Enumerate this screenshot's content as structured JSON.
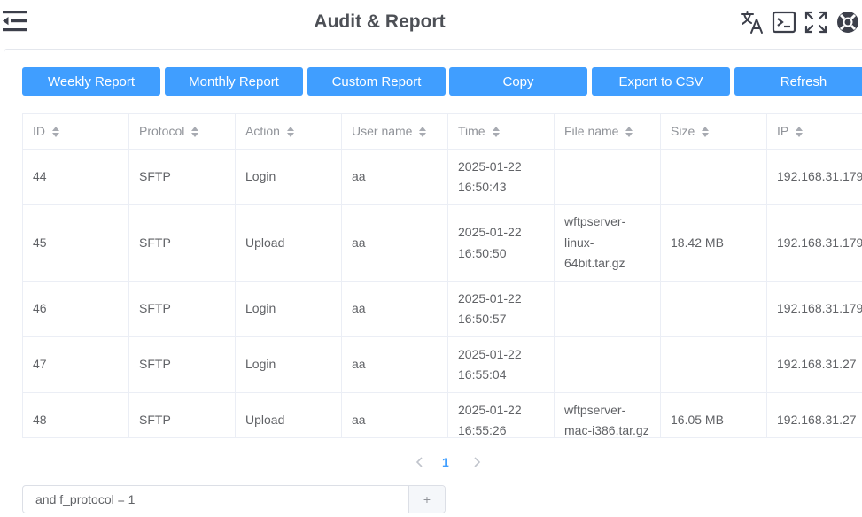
{
  "header": {
    "title": "Audit & Report",
    "icons": [
      "menu-collapse-icon",
      "translate-icon",
      "terminal-icon",
      "fullscreen-icon",
      "help-lifebuoy-icon"
    ]
  },
  "toolbar": {
    "buttons": [
      "Weekly Report",
      "Monthly Report",
      "Custom Report",
      "Copy",
      "Export to CSV",
      "Refresh"
    ]
  },
  "table": {
    "columns": [
      "ID",
      "Protocol",
      "Action",
      "User name",
      "Time",
      "File name",
      "Size",
      "IP"
    ],
    "rows": [
      {
        "id": "44",
        "protocol": "SFTP",
        "action": "Login",
        "user": "aa",
        "time": [
          "2025-01-22",
          "16:50:43"
        ],
        "file": [],
        "size": "",
        "ip": "192.168.31.179"
      },
      {
        "id": "45",
        "protocol": "SFTP",
        "action": "Upload",
        "user": "aa",
        "time": [
          "2025-01-22",
          "16:50:50"
        ],
        "file": [
          "wftpserver-",
          "linux-",
          "64bit.tar.gz"
        ],
        "size": "18.42 MB",
        "ip": "192.168.31.179"
      },
      {
        "id": "46",
        "protocol": "SFTP",
        "action": "Login",
        "user": "aa",
        "time": [
          "2025-01-22",
          "16:50:57"
        ],
        "file": [],
        "size": "",
        "ip": "192.168.31.179"
      },
      {
        "id": "47",
        "protocol": "SFTP",
        "action": "Login",
        "user": "aa",
        "time": [
          "2025-01-22",
          "16:55:04"
        ],
        "file": [],
        "size": "",
        "ip": "192.168.31.27"
      },
      {
        "id": "48",
        "protocol": "SFTP",
        "action": "Upload",
        "user": "aa",
        "time": [
          "2025-01-22",
          "16:55:26"
        ],
        "file": [
          "wftpserver-",
          "mac-i386.tar.gz"
        ],
        "size": "16.05 MB",
        "ip": "192.168.31.27"
      }
    ]
  },
  "pagination": {
    "current_page": "1",
    "prev_icon": "chevron-left-icon",
    "next_icon": "chevron-right-icon"
  },
  "filter": {
    "value": "and f_protocol = 1",
    "add_label": "+"
  },
  "colors": {
    "accent": "#409eff",
    "title": "#4d5056",
    "text": "#606266",
    "header_text": "#909399",
    "border": "#ebeef5"
  }
}
